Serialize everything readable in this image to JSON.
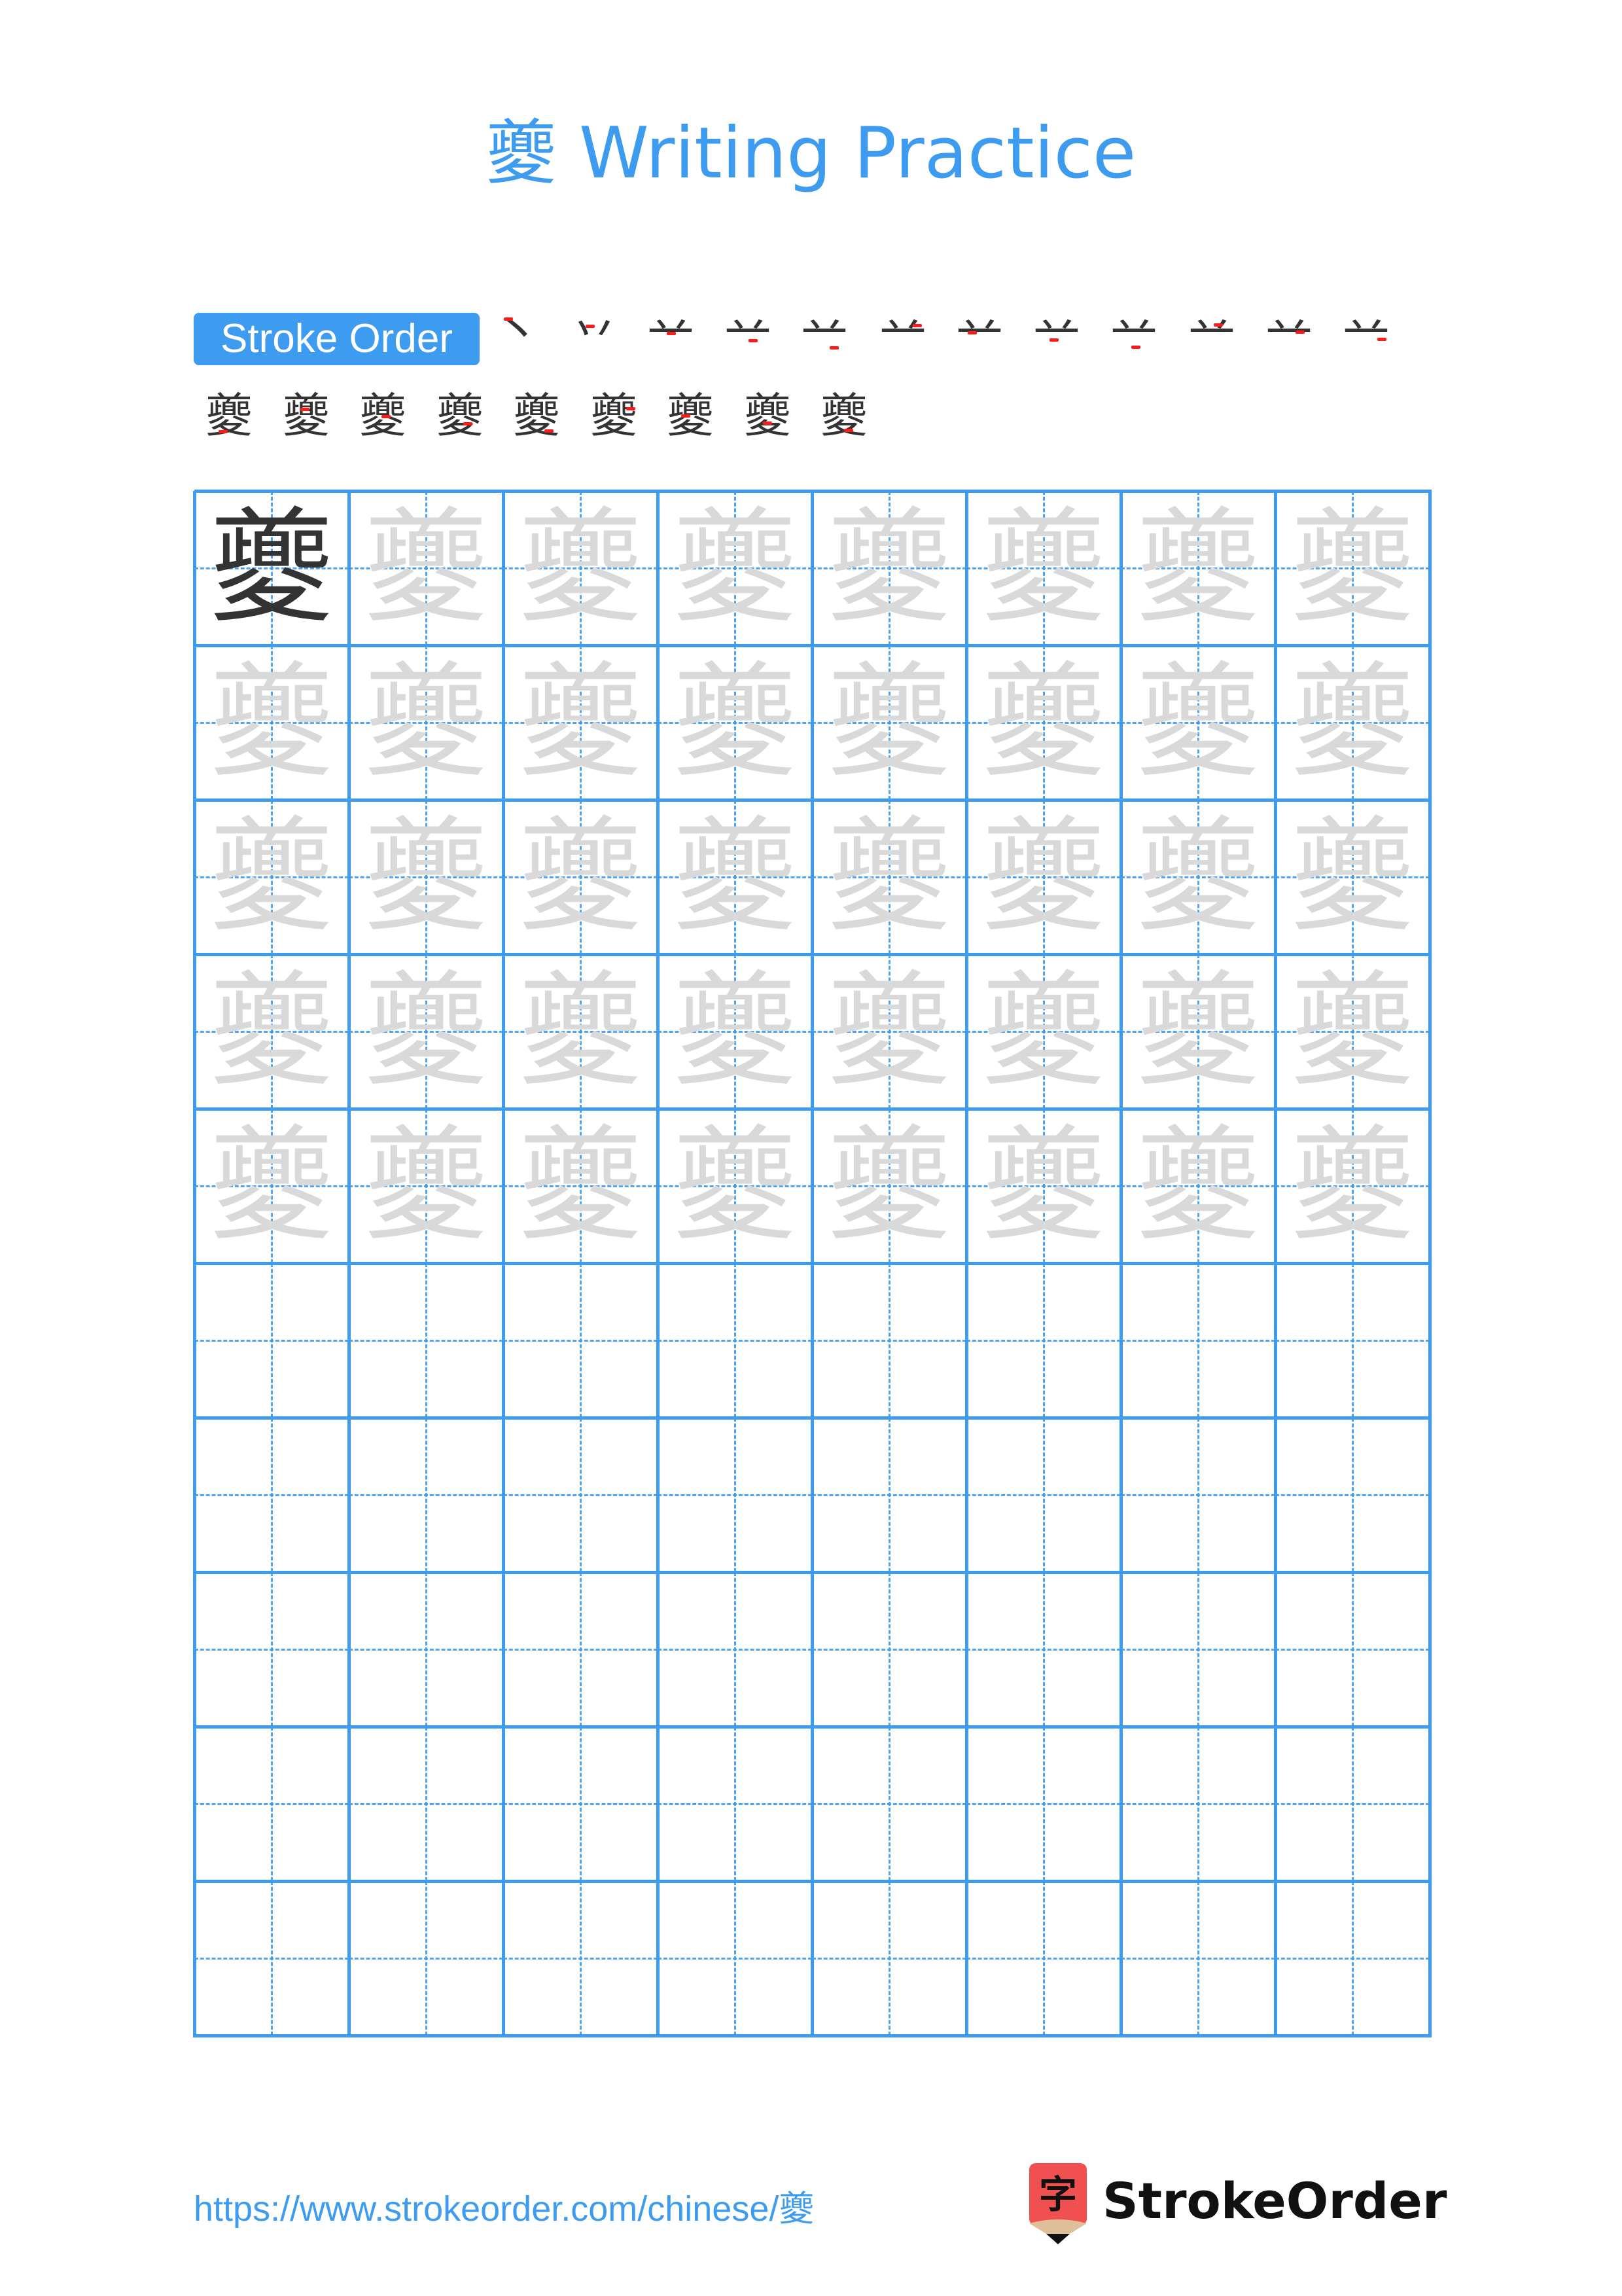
{
  "page": {
    "title": "夔 Writing Practice",
    "character": "夔",
    "accent_color": "#3d9bf0",
    "highlight_color": "#ff1a1a",
    "trace_color": "#d9d9d9",
    "ink_color": "#333333"
  },
  "stroke_order": {
    "label": "Stroke Order",
    "total_strokes": 21,
    "steps": [
      {
        "step": 1,
        "glyph": "丶"
      },
      {
        "step": 2,
        "glyph": "丷"
      },
      {
        "step": 3,
        "glyph": "䒑"
      },
      {
        "step": 4,
        "glyph": "䒑"
      },
      {
        "step": 5,
        "glyph": "䒑"
      },
      {
        "step": 6,
        "glyph": "䒑"
      },
      {
        "step": 7,
        "glyph": "䒑"
      },
      {
        "step": 8,
        "glyph": "䒑"
      },
      {
        "step": 9,
        "glyph": "䒑"
      },
      {
        "step": 10,
        "glyph": "䒑"
      },
      {
        "step": 11,
        "glyph": "䒑"
      },
      {
        "step": 12,
        "glyph": "䒑"
      },
      {
        "step": 13,
        "glyph": "夔"
      },
      {
        "step": 14,
        "glyph": "夔"
      },
      {
        "step": 15,
        "glyph": "夔"
      },
      {
        "step": 16,
        "glyph": "夔"
      },
      {
        "step": 17,
        "glyph": "夔"
      },
      {
        "step": 18,
        "glyph": "夔"
      },
      {
        "step": 19,
        "glyph": "夔"
      },
      {
        "step": 20,
        "glyph": "夔"
      },
      {
        "step": 21,
        "glyph": "夔"
      }
    ]
  },
  "practice_grid": {
    "columns": 8,
    "rows": 10,
    "model_cells": 1,
    "trace_rows": 5,
    "empty_rows": 5
  },
  "footer": {
    "url": "https://www.strokeorder.com/chinese/夔",
    "logo_text": "StrokeOrder",
    "logo_icon_glyph": "字"
  }
}
